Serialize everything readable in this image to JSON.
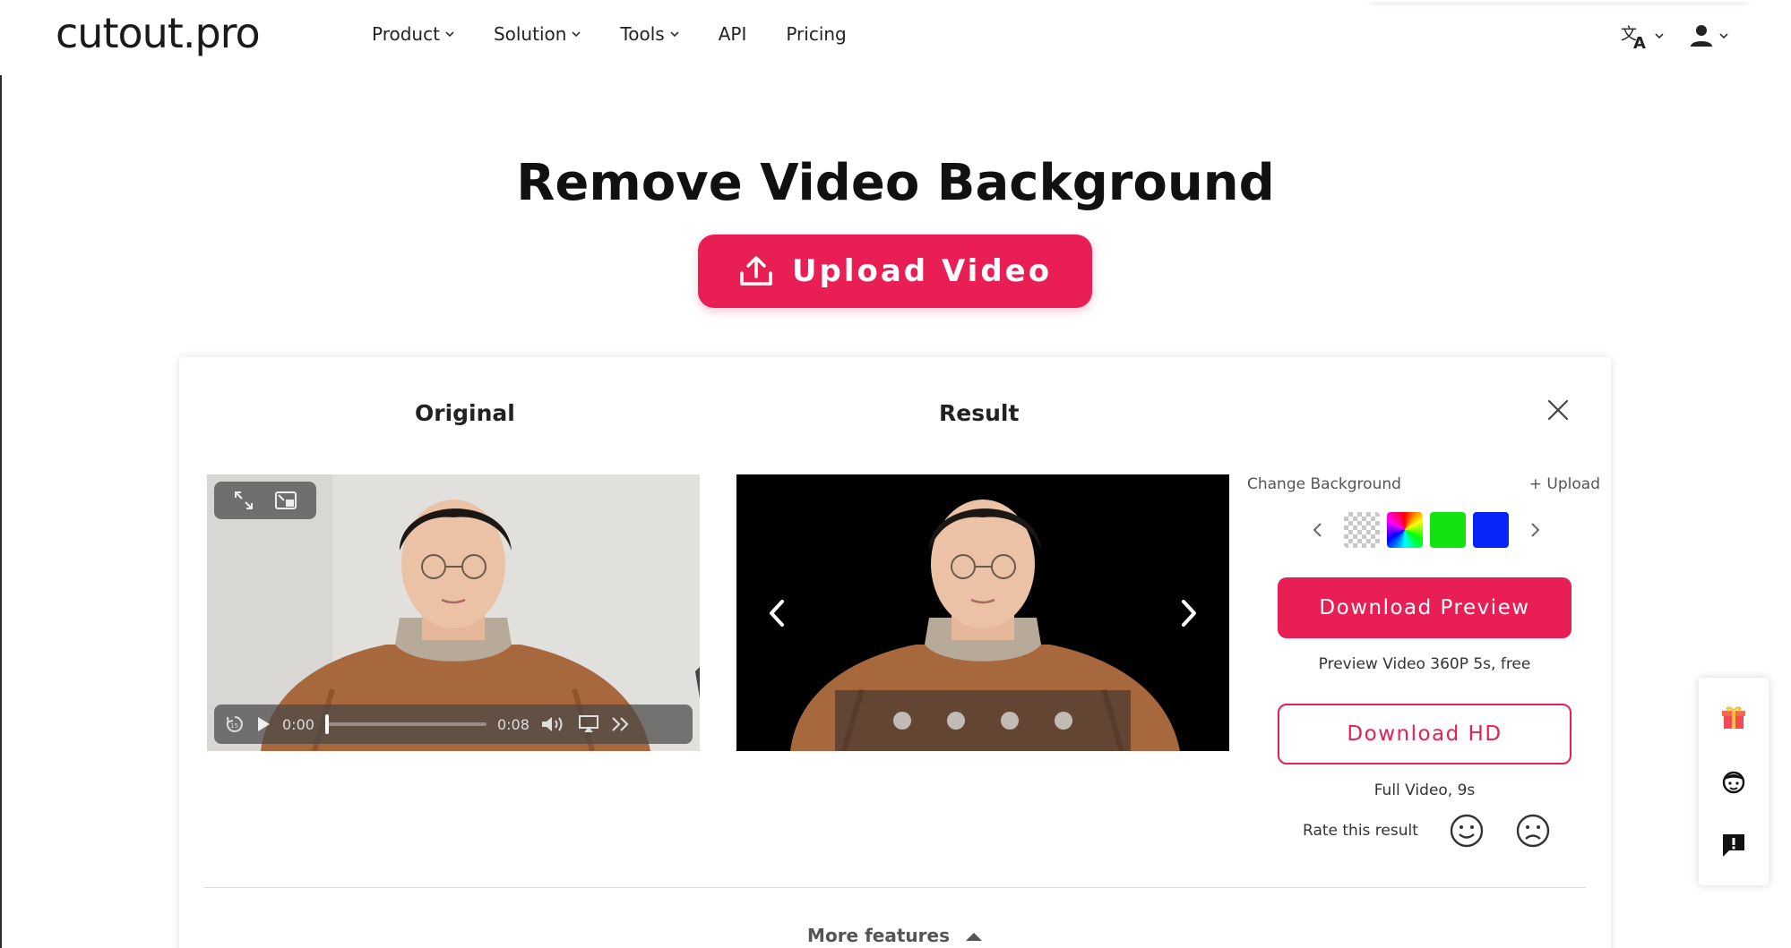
{
  "header": {
    "logo": "cutout.pro",
    "nav": [
      {
        "label": "Product",
        "has_dropdown": true
      },
      {
        "label": "Solution",
        "has_dropdown": true
      },
      {
        "label": "Tools",
        "has_dropdown": true
      },
      {
        "label": "API",
        "has_dropdown": false
      },
      {
        "label": "Pricing",
        "has_dropdown": false
      }
    ],
    "icons": [
      "translate-icon",
      "user-icon"
    ]
  },
  "hero": {
    "title": "Remove Video Background",
    "upload_label": "Upload Video"
  },
  "card": {
    "original_title": "Original",
    "result_title": "Result",
    "player": {
      "current_time": "0:00",
      "duration": "0:08",
      "progress": 0
    },
    "carousel_dots": 4,
    "side": {
      "change_background_label": "Change Background",
      "upload_label": "Upload",
      "swatches": [
        "transparent",
        "rainbow",
        "#12e30e",
        "#0625f6"
      ],
      "download_preview_label": "Download Preview",
      "preview_note": "Preview Video 360P 5s, free",
      "download_hd_label": "Download HD",
      "hd_note": "Full Video, 9s",
      "rate_label": "Rate this result"
    },
    "more_features_label": "More features"
  },
  "colors": {
    "accent": "#e91e55",
    "text": "#1a1a1a"
  }
}
